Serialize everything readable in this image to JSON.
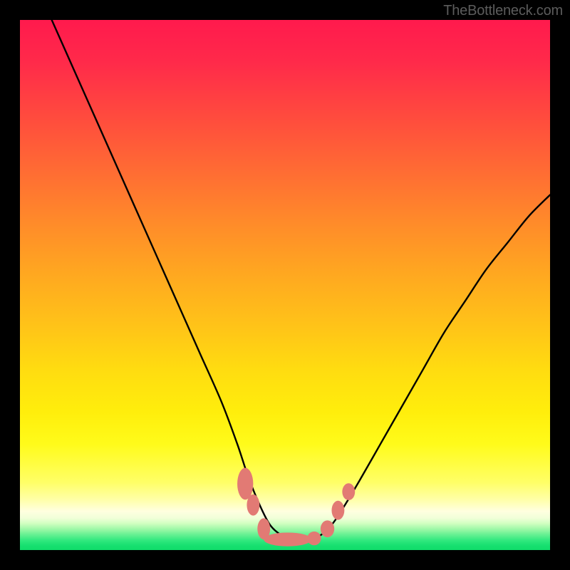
{
  "watermark": "TheBottleneck.com",
  "colors": {
    "background": "#000000",
    "curve_stroke": "#000000",
    "marker_fill": "#e27a74",
    "gradient_top": "#ff1a4d",
    "gradient_bottom": "#10dc6a"
  },
  "chart_data": {
    "type": "line",
    "title": "",
    "xlabel": "",
    "ylabel": "",
    "x_range": [
      0,
      100
    ],
    "y_range": [
      0,
      100
    ],
    "series": [
      {
        "name": "bottleneck-curve",
        "x": [
          6,
          10,
          14,
          18,
          22,
          26,
          30,
          34,
          38,
          41,
          43,
          45,
          47,
          49,
          51,
          53,
          55,
          57,
          59,
          61,
          64,
          68,
          72,
          76,
          80,
          84,
          88,
          92,
          96,
          100
        ],
        "y": [
          100,
          91,
          82,
          73,
          64,
          55,
          46,
          37,
          28,
          20,
          14,
          9,
          5,
          3,
          2,
          2,
          2,
          3,
          5,
          8,
          13,
          20,
          27,
          34,
          41,
          47,
          53,
          58,
          63,
          67
        ]
      }
    ],
    "markers": [
      {
        "x": 42.5,
        "y": 12.5,
        "rx": 1.5,
        "ry": 3.0
      },
      {
        "x": 44.0,
        "y": 8.5,
        "rx": 1.2,
        "ry": 2.0
      },
      {
        "x": 46.0,
        "y": 4.0,
        "rx": 1.2,
        "ry": 2.0
      },
      {
        "x": 50.5,
        "y": 2.0,
        "rx": 4.5,
        "ry": 1.3
      },
      {
        "x": 55.5,
        "y": 2.2,
        "rx": 1.3,
        "ry": 1.3
      },
      {
        "x": 58.0,
        "y": 4.0,
        "rx": 1.3,
        "ry": 1.6
      },
      {
        "x": 60.0,
        "y": 7.5,
        "rx": 1.2,
        "ry": 1.8
      },
      {
        "x": 62.0,
        "y": 11.0,
        "rx": 1.2,
        "ry": 1.6
      }
    ]
  }
}
